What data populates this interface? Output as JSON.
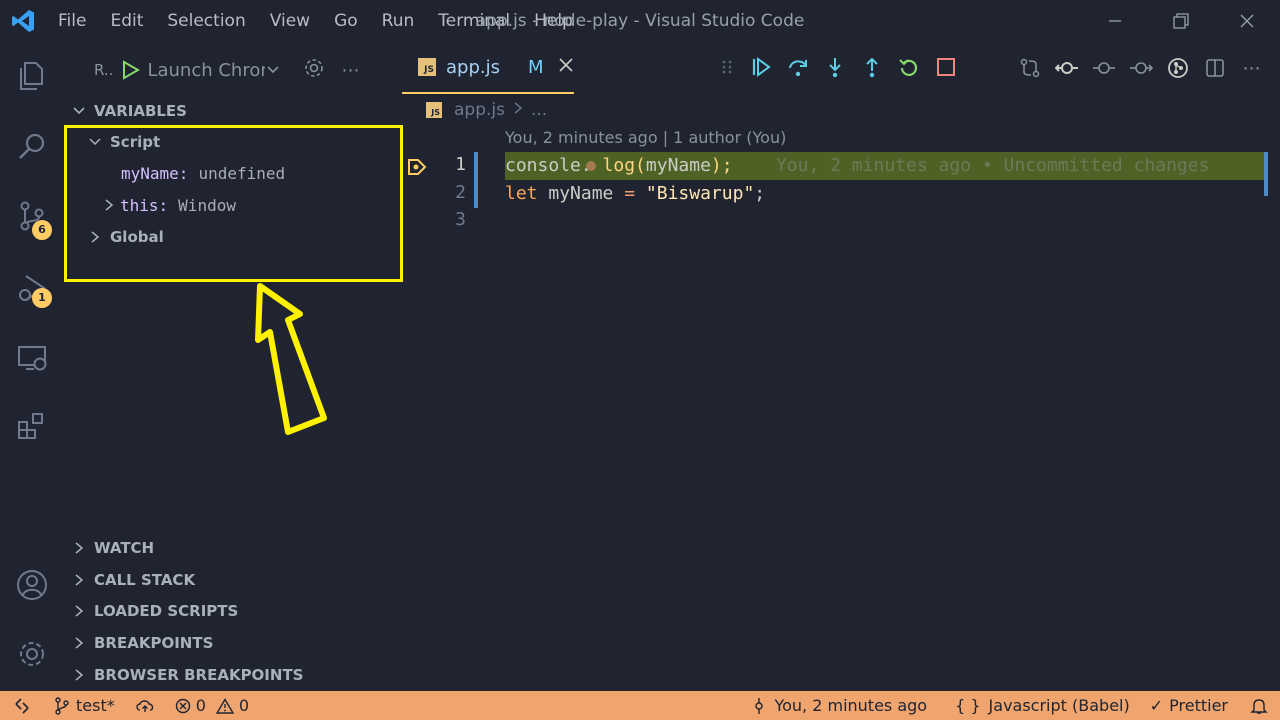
{
  "menu": [
    "File",
    "Edit",
    "Selection",
    "View",
    "Go",
    "Run",
    "Terminal",
    "Help"
  ],
  "window_title": "app.js - node-play - Visual Studio Code",
  "activity": {
    "scm_badge": "6",
    "debug_badge": "1"
  },
  "sidebar": {
    "run_label": "R..",
    "launch_config": "Launch Chrome",
    "variables_header": "VARIABLES",
    "script_label": "Script",
    "var_myname_key": "myName:",
    "var_myname_value": "undefined",
    "var_this_key": "this:",
    "var_this_value": "Window",
    "global_label": "Global",
    "sections": [
      "WATCH",
      "CALL STACK",
      "LOADED SCRIPTS",
      "BREAKPOINTS",
      "BROWSER BREAKPOINTS"
    ]
  },
  "editor": {
    "tab_icon": "JS",
    "tab_name": "app.js",
    "tab_modified": "M",
    "breadcrumb_file": "app.js",
    "breadcrumb_rest": "...",
    "codelens": "You, 2 minutes ago | 1 author (You)",
    "line_numbers": [
      "1",
      "2",
      "3"
    ],
    "line1_a": "console.",
    "line1_b": " log(",
    "line1_c": "myName",
    "line1_d": ");",
    "line1_blame": "    You, 2 minutes ago • Uncommitted changes",
    "line2_let": "let",
    "line2_var": " myName ",
    "line2_eq": "= ",
    "line2_str": "\"Biswarup\"",
    "line2_end": ";"
  },
  "statusbar": {
    "branch": "test*",
    "errors": "0",
    "warnings": "0",
    "blame": "You, 2 minutes ago",
    "language": "Javascript (Babel)",
    "prettier": "Prettier"
  },
  "colors": {
    "background": "#1f2430",
    "accent": "#ffcc66",
    "statusbar": "#f0a46e",
    "highlight": "#fff200",
    "debug_blue": "#5ccfe6"
  }
}
